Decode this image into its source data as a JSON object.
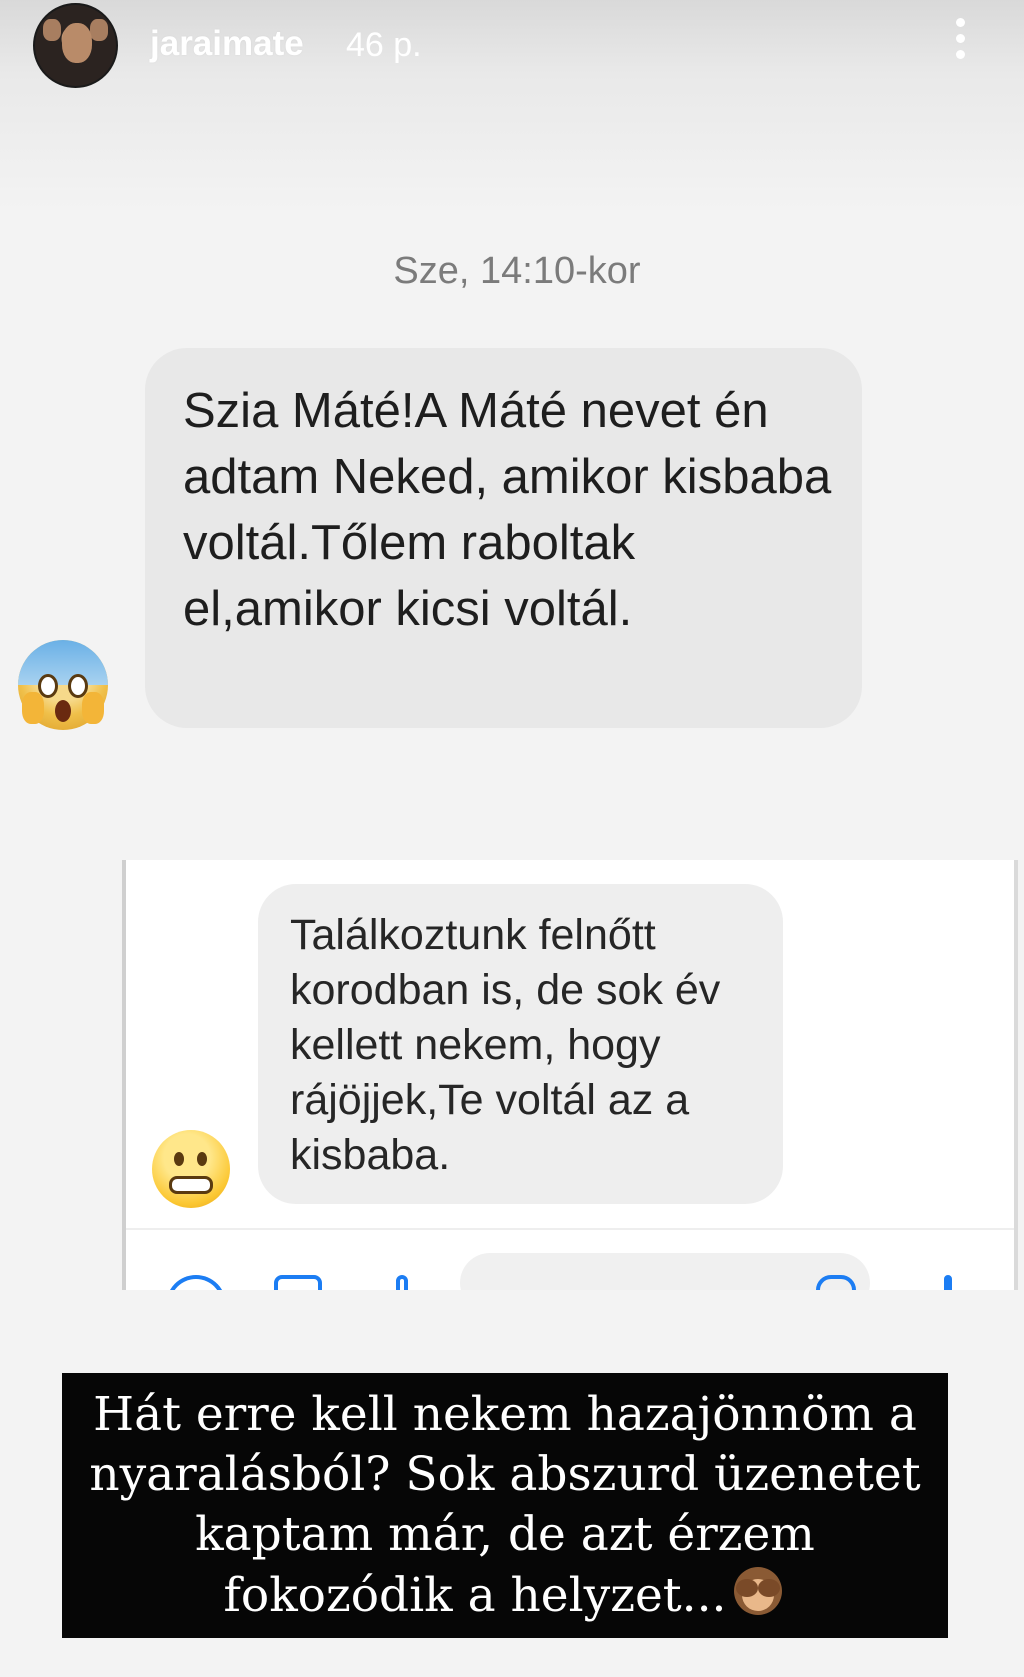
{
  "story": {
    "username": "jaraimate",
    "time_ago": "46 p."
  },
  "message_1": {
    "timestamp": "Sze, 14:10-kor",
    "text": "Szia Máté!A Máté nevet én adtam Neked, amikor kisbaba voltál.Tőlem raboltak el,amikor kicsi voltál.",
    "emoji": "face-screaming-in-fear"
  },
  "message_2": {
    "text": "Találkoztunk felnőtt korodban is, de sok év kellett nekem, hogy rájöjjek,Te voltál az a kisbaba.",
    "emoji": "grimacing-face"
  },
  "caption": {
    "text": "Hát erre kell nekem hazajönnöm a nyaralásból? Sok abszurd üzenetet kaptam már, de azt érzem fokozódik a helyzet...",
    "emoji": "see-no-evil-monkey"
  },
  "colors": {
    "bubble": "#e8e8e8",
    "caption_bg": "#060606",
    "messenger_blue": "#1c7df3"
  }
}
